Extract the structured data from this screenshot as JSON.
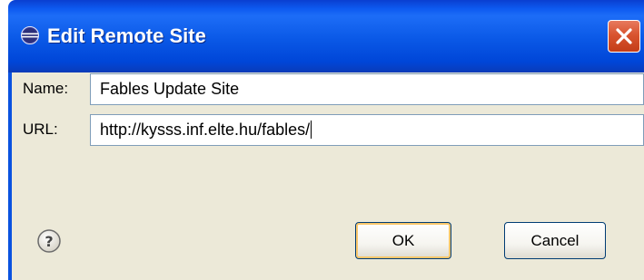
{
  "window": {
    "title": "Edit Remote Site",
    "title_icon": "eclipse-icon",
    "close_icon": "close-icon"
  },
  "form": {
    "name_label": "Name:",
    "name_value": "Fables Update Site",
    "url_label": "URL:",
    "url_value": "http://kysss.inf.elte.hu/fables/"
  },
  "buttons": {
    "ok_label": "OK",
    "cancel_label": "Cancel",
    "help_icon": "help-icon"
  },
  "colors": {
    "titlebar": "#0a58e6",
    "dialog_bg": "#ece9d8",
    "close_button": "#d9542f",
    "field_border": "#7f9db9"
  }
}
